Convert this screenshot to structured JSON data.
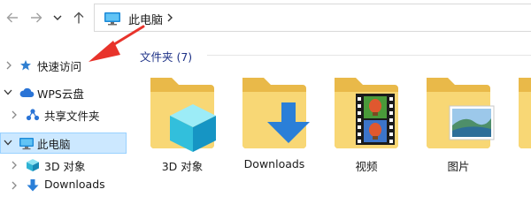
{
  "address": {
    "path_label": "此电脑"
  },
  "sidebar": {
    "items": [
      {
        "label": "快速访问",
        "icon": "star-icon",
        "indent": 0,
        "expanded": false,
        "selected": false
      },
      {
        "label": "WPS云盘",
        "icon": "cloud-icon",
        "indent": 0,
        "expanded": true,
        "selected": false
      },
      {
        "label": "共享文件夹",
        "icon": "share-icon",
        "indent": 1,
        "expanded": false,
        "selected": false
      },
      {
        "label": "此电脑",
        "icon": "computer-icon",
        "indent": 0,
        "expanded": true,
        "selected": true
      },
      {
        "label": "3D 对象",
        "icon": "3d-objects-icon",
        "indent": 1,
        "expanded": false,
        "selected": false
      },
      {
        "label": "Downloads",
        "icon": "download-icon",
        "indent": 1,
        "expanded": false,
        "selected": false
      }
    ]
  },
  "content": {
    "group_header": "文件夹 (7)",
    "folders": [
      {
        "label": "3D 对象",
        "icon": "3d-objects-folder-icon"
      },
      {
        "label": "Downloads",
        "icon": "downloads-folder-icon"
      },
      {
        "label": "视频",
        "icon": "videos-folder-icon"
      },
      {
        "label": "图片",
        "icon": "pictures-folder-icon"
      }
    ]
  },
  "colors": {
    "selection_bg": "#cce8ff",
    "selection_border": "#99d1ff",
    "folder_yellow": "#f8d775",
    "group_header": "#1e3287",
    "annotation_red": "#e8332b"
  }
}
